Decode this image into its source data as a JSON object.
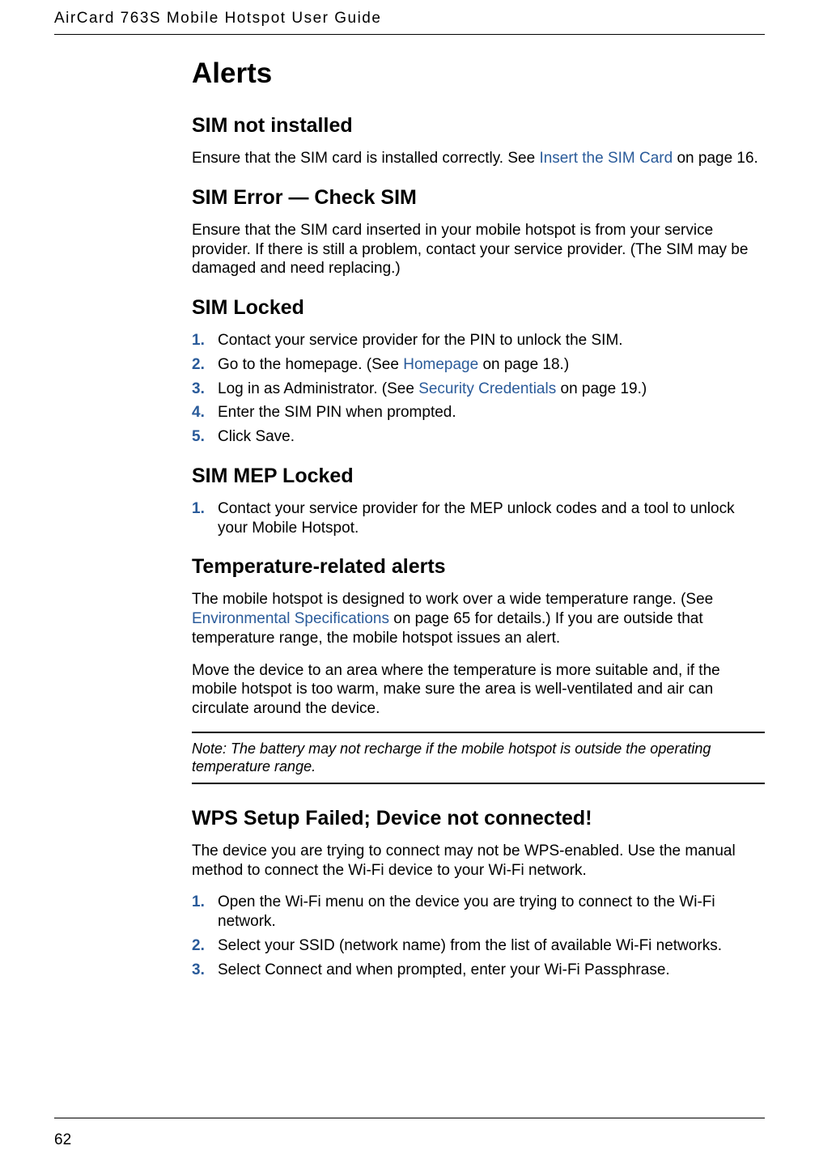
{
  "header": {
    "doc_title": "AirCard 763S Mobile Hotspot User Guide"
  },
  "main": {
    "h1": "Alerts",
    "sections": {
      "sim_not_installed": {
        "title": "SIM not installed",
        "p1_a": "Ensure that the SIM card is installed correctly. See ",
        "p1_link": "Insert the SIM Card",
        "p1_b": " on page 16."
      },
      "sim_error": {
        "title": "SIM Error — Check SIM",
        "p1": "Ensure that the SIM card inserted in your mobile hotspot is from your service provider. If there is still a problem, contact your service provider. (The SIM may be damaged and need replacing.)"
      },
      "sim_locked": {
        "title": "SIM Locked",
        "items": {
          "i1": "Contact your service provider for the PIN to unlock the SIM.",
          "i2_a": "Go to the homepage. (See ",
          "i2_link": "Homepage",
          "i2_b": " on page 18.)",
          "i3_a": "Log in as Administrator. (See ",
          "i3_link": "Security Credentials",
          "i3_b": " on page 19.)",
          "i4": "Enter the SIM PIN when prompted.",
          "i5": "Click Save."
        }
      },
      "sim_mep": {
        "title": "SIM MEP Locked",
        "items": {
          "i1": "Contact your service provider for the MEP unlock codes and a tool to unlock your Mobile Hotspot."
        }
      },
      "temp": {
        "title": "Temperature-related alerts",
        "p1_a": "The mobile hotspot is designed to work over a wide temperature range. (See ",
        "p1_link": "Environmental Specifications",
        "p1_b": " on page 65 for details.) If you are outside that temperature range, the mobile hotspot issues an alert.",
        "p2": "Move the device to an area where the temperature is more suitable and, if the mobile hotspot is too warm, make sure the area is well-ventilated and air can circulate around the device.",
        "note": "Note:  The battery may not recharge if the mobile hotspot is outside the operating temperature range."
      },
      "wps": {
        "title": "WPS Setup Failed; Device not connected!",
        "p1": "The device you are trying to connect may not be WPS-enabled. Use the manual method to connect the Wi-Fi device to your Wi-Fi network.",
        "items": {
          "i1": "Open the Wi-Fi menu on the device you are trying to connect to the Wi-Fi network.",
          "i2": "Select your SSID (network name) from the list of available Wi-Fi networks.",
          "i3": "Select Connect and when prompted, enter your Wi-Fi Passphrase."
        }
      }
    }
  },
  "footer": {
    "page_num": "62"
  }
}
